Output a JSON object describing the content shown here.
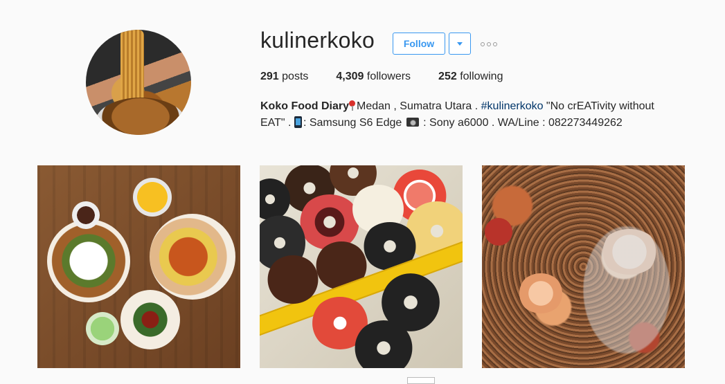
{
  "profile": {
    "username": "kulinerkoko",
    "follow_label": "Follow",
    "stats": {
      "posts_count": "291",
      "posts_label": "posts",
      "followers_count": "4,309",
      "followers_label": "followers",
      "following_count": "252",
      "following_label": "following"
    },
    "bio": {
      "name": "Koko Food Diary",
      "location": "Medan , Sumatra Utara . ",
      "hashtag": "#kulinerkoko",
      "line1_rest": " \"No crEATivity without",
      "line2_start": "EAT\" . ",
      "phone_text": ": Samsung S6 Edge ",
      "camera_text": " : Sony a6000 . WA/Line : 082273449262"
    }
  },
  "icons": {
    "dropdown": "chevron-down-icon",
    "more": "more-options-icon",
    "location": "round-pushpin-icon",
    "phone": "mobile-phone-icon",
    "camera": "camera-icon"
  },
  "colors": {
    "accent": "#3897f0",
    "hashtag": "#003569",
    "text": "#262626",
    "background": "#fafafa"
  }
}
